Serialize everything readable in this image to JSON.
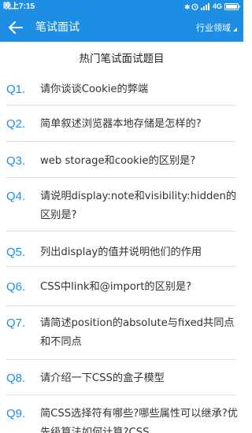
{
  "status_bar": {
    "time": "晚上7:15",
    "network": "4G",
    "icons": [
      "bluetooth-icon",
      "alarm-icon",
      "signal-icon",
      "battery-icon"
    ]
  },
  "app_bar": {
    "title": "笔试面试",
    "back_icon": "back-arrow-icon",
    "filter_label": "行业领域",
    "color": "#1e8ee5"
  },
  "page": {
    "title": "热门笔试面试题目"
  },
  "questions": [
    {
      "num": "Q1.",
      "text": "请你谈谈Cookie的弊端"
    },
    {
      "num": "Q2.",
      "text": "简单叙述浏览器本地存储是怎样的?"
    },
    {
      "num": "Q3.",
      "text": "web storage和cookie的区别是?"
    },
    {
      "num": "Q4.",
      "text": "请说明display:note和visibility:hidden的区别是?"
    },
    {
      "num": "Q5.",
      "text": "列出display的值并说明他们的作用"
    },
    {
      "num": "Q6.",
      "text": "CSS中link和@import的区别是?"
    },
    {
      "num": "Q7.",
      "text": "请简述position的absolute与fixed共同点和不同点"
    },
    {
      "num": "Q8.",
      "text": "请介绍一下CSS的盒子模型"
    },
    {
      "num": "Q9.",
      "text": "简CSS选择符有哪些?哪些属性可以继承?优先级算法如何计算?CSS"
    }
  ],
  "accent_color": "#1e8ee5"
}
